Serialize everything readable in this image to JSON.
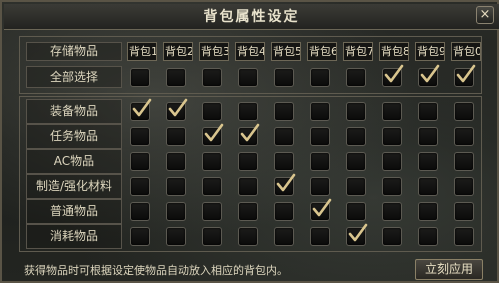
{
  "window": {
    "title": "背包属性设定",
    "close_label": "×"
  },
  "header": {
    "row_label": "存储物品",
    "bags": [
      "背包1",
      "背包2",
      "背包3",
      "背包4",
      "背包5",
      "背包6",
      "背包7",
      "背包8",
      "背包9",
      "背包0"
    ]
  },
  "select_all": {
    "label": "全部选择",
    "checked": [
      false,
      false,
      false,
      false,
      false,
      false,
      false,
      true,
      true,
      true
    ]
  },
  "categories": [
    {
      "label": "装备物品",
      "checked": [
        true,
        true,
        false,
        false,
        false,
        false,
        false,
        false,
        false,
        false
      ]
    },
    {
      "label": "任务物品",
      "checked": [
        false,
        false,
        true,
        true,
        false,
        false,
        false,
        false,
        false,
        false
      ]
    },
    {
      "label": "AC物品",
      "checked": [
        false,
        false,
        false,
        false,
        false,
        false,
        false,
        false,
        false,
        false
      ]
    },
    {
      "label": "制造/强化材料",
      "checked": [
        false,
        false,
        false,
        false,
        true,
        false,
        false,
        false,
        false,
        false
      ]
    },
    {
      "label": "普通物品",
      "checked": [
        false,
        false,
        false,
        false,
        false,
        true,
        false,
        false,
        false,
        false
      ]
    },
    {
      "label": "消耗物品",
      "checked": [
        false,
        false,
        false,
        false,
        false,
        false,
        true,
        false,
        false,
        false
      ]
    }
  ],
  "footer": {
    "hint": "获得物品时可根据设定使物品自动放入相应的背包内。",
    "apply_label": "立刻应用"
  },
  "colors": {
    "check": "#d9c58e",
    "border": "#5f5b4f",
    "text": "#ddd6be"
  }
}
